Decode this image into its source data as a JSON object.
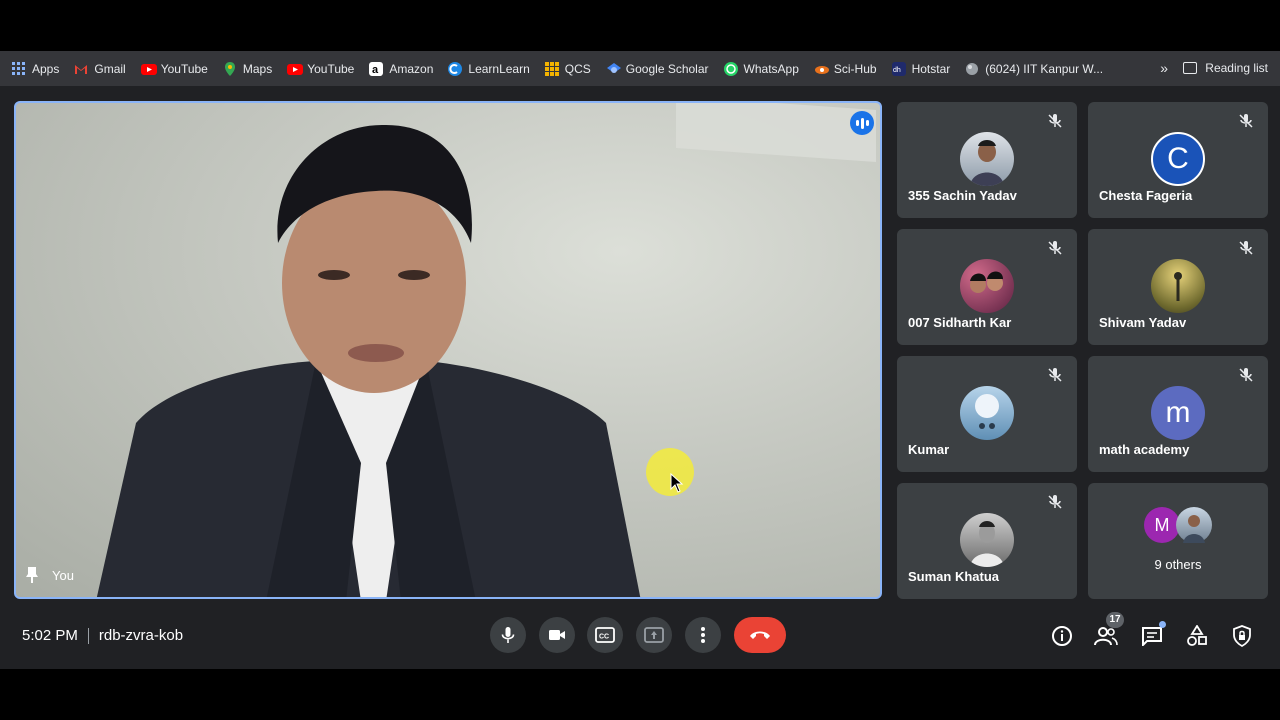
{
  "bookmarks": {
    "items": [
      {
        "label": "Apps",
        "icon": "apps-grid-icon",
        "color": "#8ab4f8"
      },
      {
        "label": "Gmail",
        "icon": "gmail-icon",
        "color": "#ea4335"
      },
      {
        "label": "YouTube",
        "icon": "youtube-icon",
        "color": "#ff0000"
      },
      {
        "label": "Maps",
        "icon": "maps-icon",
        "color": "#34a853"
      },
      {
        "label": "YouTube",
        "icon": "youtube-icon",
        "color": "#ff0000"
      },
      {
        "label": "Amazon",
        "icon": "amazon-icon",
        "color": "#ffffff"
      },
      {
        "label": "LearnLearn",
        "icon": "learnlearn-icon",
        "color": "#1e88e5"
      },
      {
        "label": "QCS",
        "icon": "qcs-grid-icon",
        "color": "#f4b400"
      },
      {
        "label": "Google Scholar",
        "icon": "scholar-icon",
        "color": "#4285f4"
      },
      {
        "label": "WhatsApp",
        "icon": "whatsapp-icon",
        "color": "#25d366"
      },
      {
        "label": "Sci-Hub",
        "icon": "scihub-icon",
        "color": "#e8711c"
      },
      {
        "label": "Hotstar",
        "icon": "hotstar-icon",
        "color": "#1f2a6b"
      },
      {
        "label": "(6024) IIT Kanpur W...",
        "icon": "site-icon",
        "color": "#9aa0a6"
      }
    ],
    "more": "»",
    "reading_list": "Reading list"
  },
  "main_tile": {
    "label": "You"
  },
  "participants": [
    {
      "name": "355 Sachin Yadav",
      "avatar_type": "photo",
      "color": "#8c9aa8"
    },
    {
      "name": "Chesta Fageria",
      "avatar_type": "letter",
      "letter": "C",
      "color": "#1a53b8"
    },
    {
      "name": "007 Sidharth Kar",
      "avatar_type": "photo",
      "color": "#a0566a"
    },
    {
      "name": "Shivam Yadav",
      "avatar_type": "photo",
      "color": "#8b7a3a"
    },
    {
      "name": "Kumar",
      "avatar_type": "photo",
      "color": "#8fb6d6"
    },
    {
      "name": "math academy",
      "avatar_type": "letter",
      "letter": "m",
      "color": "#5c6bc0"
    },
    {
      "name": "Suman Khatua",
      "avatar_type": "photo",
      "color": "#6b6b6b"
    }
  ],
  "others": {
    "label": "9 others",
    "letter": "M",
    "letter_color": "#9c27b0"
  },
  "bottom_bar": {
    "time": "5:02 PM",
    "meeting_code": "rdb-zvra-kob",
    "people_count": "17"
  },
  "colors": {
    "accent": "#8ab4f8",
    "end_call": "#ea4335",
    "tile_bg": "#3c4043",
    "meet_bg": "#202124"
  }
}
